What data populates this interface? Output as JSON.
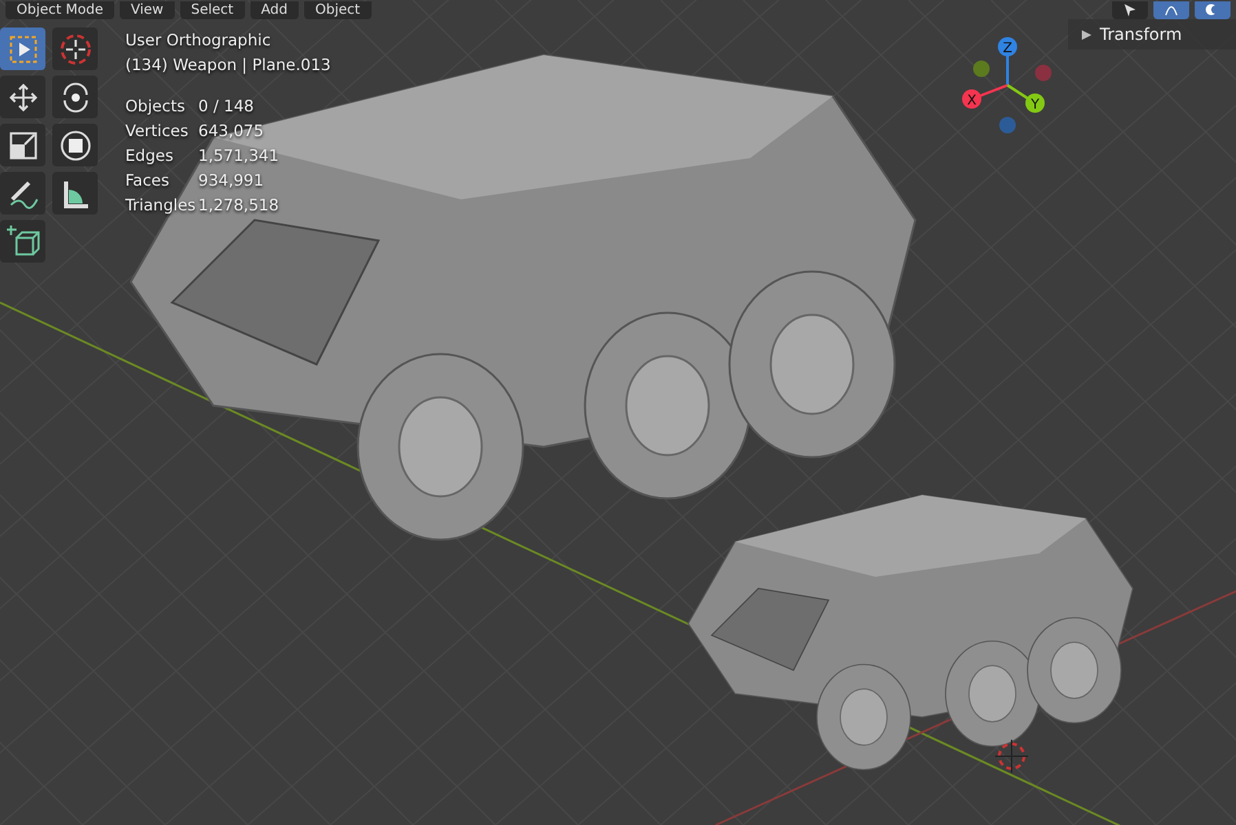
{
  "header": {
    "mode": "Object Mode",
    "menus": [
      "View",
      "Select",
      "Add",
      "Object"
    ],
    "tools": [
      {
        "kind": "cursor",
        "selected": false
      },
      {
        "kind": "curve",
        "selected": true
      },
      {
        "kind": "overlay",
        "selected": true
      }
    ]
  },
  "overlay": {
    "view": "User Orthographic",
    "object": "(134) Weapon | Plane.013",
    "stats": [
      {
        "label": "Objects",
        "value": "0 / 148"
      },
      {
        "label": "Vertices",
        "value": "643,075"
      },
      {
        "label": "Edges",
        "value": "1,571,341"
      },
      {
        "label": "Faces",
        "value": "934,991"
      },
      {
        "label": "Triangles",
        "value": "1,278,518"
      }
    ]
  },
  "toolbar": [
    {
      "kind": "select",
      "selected": true
    },
    {
      "kind": "cursor3d",
      "selected": false
    },
    {
      "kind": "move",
      "selected": false
    },
    {
      "kind": "rotate",
      "selected": false
    },
    {
      "kind": "scale",
      "selected": false
    },
    {
      "kind": "transform",
      "selected": false
    },
    {
      "kind": "annotate",
      "selected": false
    },
    {
      "kind": "measure",
      "selected": false
    },
    {
      "kind": "add-cube",
      "selected": false
    }
  ],
  "gizmo": {
    "axes": [
      {
        "label": "Z",
        "color": "#2f83e3"
      },
      {
        "label": "X",
        "color": "#f5344f"
      },
      {
        "label": "Y",
        "color": "#83c914"
      }
    ]
  },
  "sidebar": {
    "panel": "Transform",
    "expanded": false
  }
}
